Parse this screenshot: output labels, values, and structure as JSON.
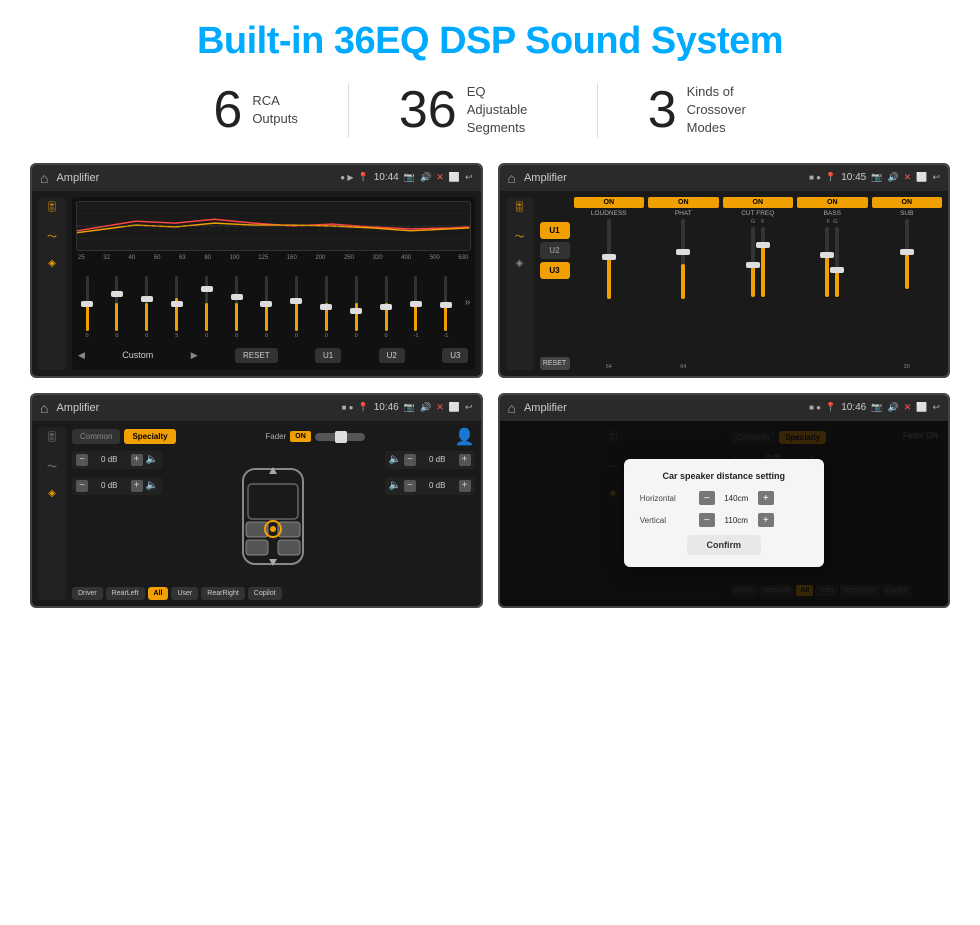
{
  "header": {
    "title": "Built-in 36EQ DSP Sound System"
  },
  "stats": [
    {
      "number": "6",
      "label": "RCA\nOutputs"
    },
    {
      "number": "36",
      "label": "EQ Adjustable\nSegments"
    },
    {
      "number": "3",
      "label": "Kinds of\nCrossover Modes"
    }
  ],
  "screens": [
    {
      "id": "screen1",
      "statusBar": {
        "appTitle": "Amplifier",
        "time": "10:44"
      },
      "type": "eq"
    },
    {
      "id": "screen2",
      "statusBar": {
        "appTitle": "Amplifier",
        "time": "10:45"
      },
      "type": "crossover"
    },
    {
      "id": "screen3",
      "statusBar": {
        "appTitle": "Amplifier",
        "time": "10:46"
      },
      "type": "fader"
    },
    {
      "id": "screen4",
      "statusBar": {
        "appTitle": "Amplifier",
        "time": "10:46"
      },
      "type": "distance",
      "dialog": {
        "title": "Car speaker distance setting",
        "horizontal": {
          "label": "Horizontal",
          "value": "140cm"
        },
        "vertical": {
          "label": "Vertical",
          "value": "110cm"
        },
        "confirmLabel": "Confirm"
      }
    }
  ],
  "eq": {
    "freqLabels": [
      "25",
      "32",
      "40",
      "50",
      "63",
      "80",
      "100",
      "125",
      "160",
      "200",
      "250",
      "320",
      "400",
      "500",
      "630"
    ],
    "values": [
      "0",
      "0",
      "0",
      "5",
      "0",
      "0",
      "0",
      "0",
      "0",
      "0",
      "0",
      "0",
      "-1",
      "-1"
    ],
    "presets": [
      "Custom",
      "RESET",
      "U1",
      "U2",
      "U3"
    ]
  },
  "crossover": {
    "presets": [
      "U1",
      "U2",
      "U3"
    ],
    "channels": [
      "LOUDNESS",
      "PHAT",
      "CUT FREQ",
      "BASS",
      "SUB"
    ],
    "resetLabel": "RESET"
  },
  "fader": {
    "tabs": [
      "Common",
      "Specialty"
    ],
    "faderLabel": "Fader",
    "onLabel": "ON",
    "leftValues": [
      "0 dB",
      "0 dB"
    ],
    "rightValues": [
      "0 dB",
      "0 dB"
    ],
    "bottomBtns": [
      "Driver",
      "RearLeft",
      "All",
      "User",
      "RearRight",
      "Copilot"
    ]
  },
  "distance_dialog": {
    "title": "Car speaker distance setting",
    "horizontal_label": "Horizontal",
    "horizontal_value": "140cm",
    "vertical_label": "Vertical",
    "vertical_value": "110cm",
    "confirm_label": "Confirm"
  }
}
